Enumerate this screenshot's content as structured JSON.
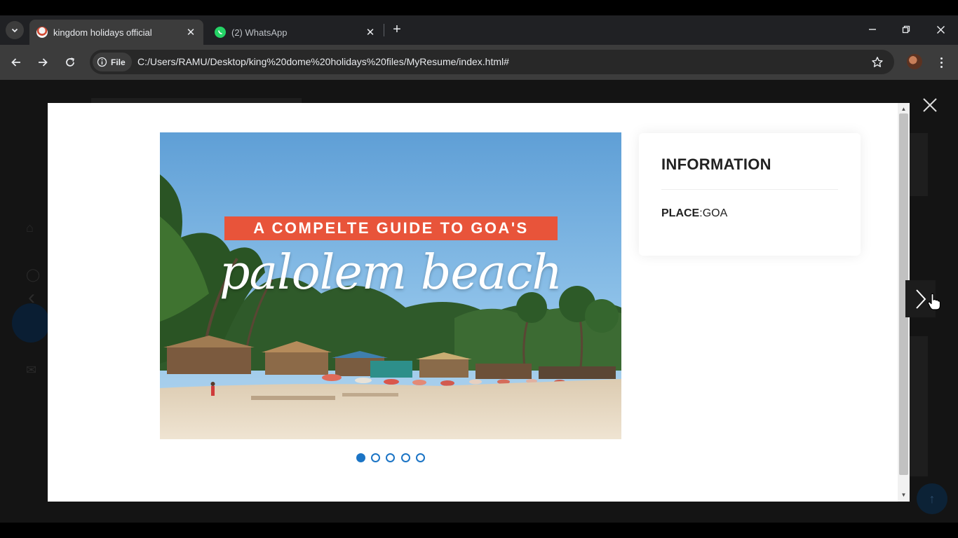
{
  "browser": {
    "tabs": [
      {
        "title": "kingdom holidays official",
        "active": true,
        "close": "✕"
      },
      {
        "title": "(2) WhatsApp",
        "active": false,
        "close": "✕"
      }
    ],
    "new_tab": "+",
    "address": {
      "security_chip": "File",
      "url": "C:/Users/RAMU/Desktop/king%20dome%20holidays%20files/MyResume/index.html#"
    },
    "icons": [
      "tab-list-icon",
      "back-icon",
      "forward-icon",
      "reload-icon",
      "info-icon",
      "star-icon",
      "profile-avatar",
      "kebab-icon",
      "minimize-icon",
      "restore-icon",
      "window-close-icon"
    ]
  },
  "lightbox": {
    "photo": {
      "banner": "A COMPELTE GUIDE TO GOA'S",
      "script_text": "palolem beach"
    },
    "pagination": {
      "count": 5,
      "active_index": 0
    },
    "info": {
      "title": "INFORMATION",
      "place_label": "PLACE",
      "place_sep": ":",
      "place_value": "GOA"
    }
  },
  "colors": {
    "accent": "#1b74c5",
    "banner": "#e8543a",
    "sky": "#74aede",
    "sand": "#e9dcc6",
    "chrome_dark": "#202124",
    "toolbar": "#3c3c3c"
  }
}
